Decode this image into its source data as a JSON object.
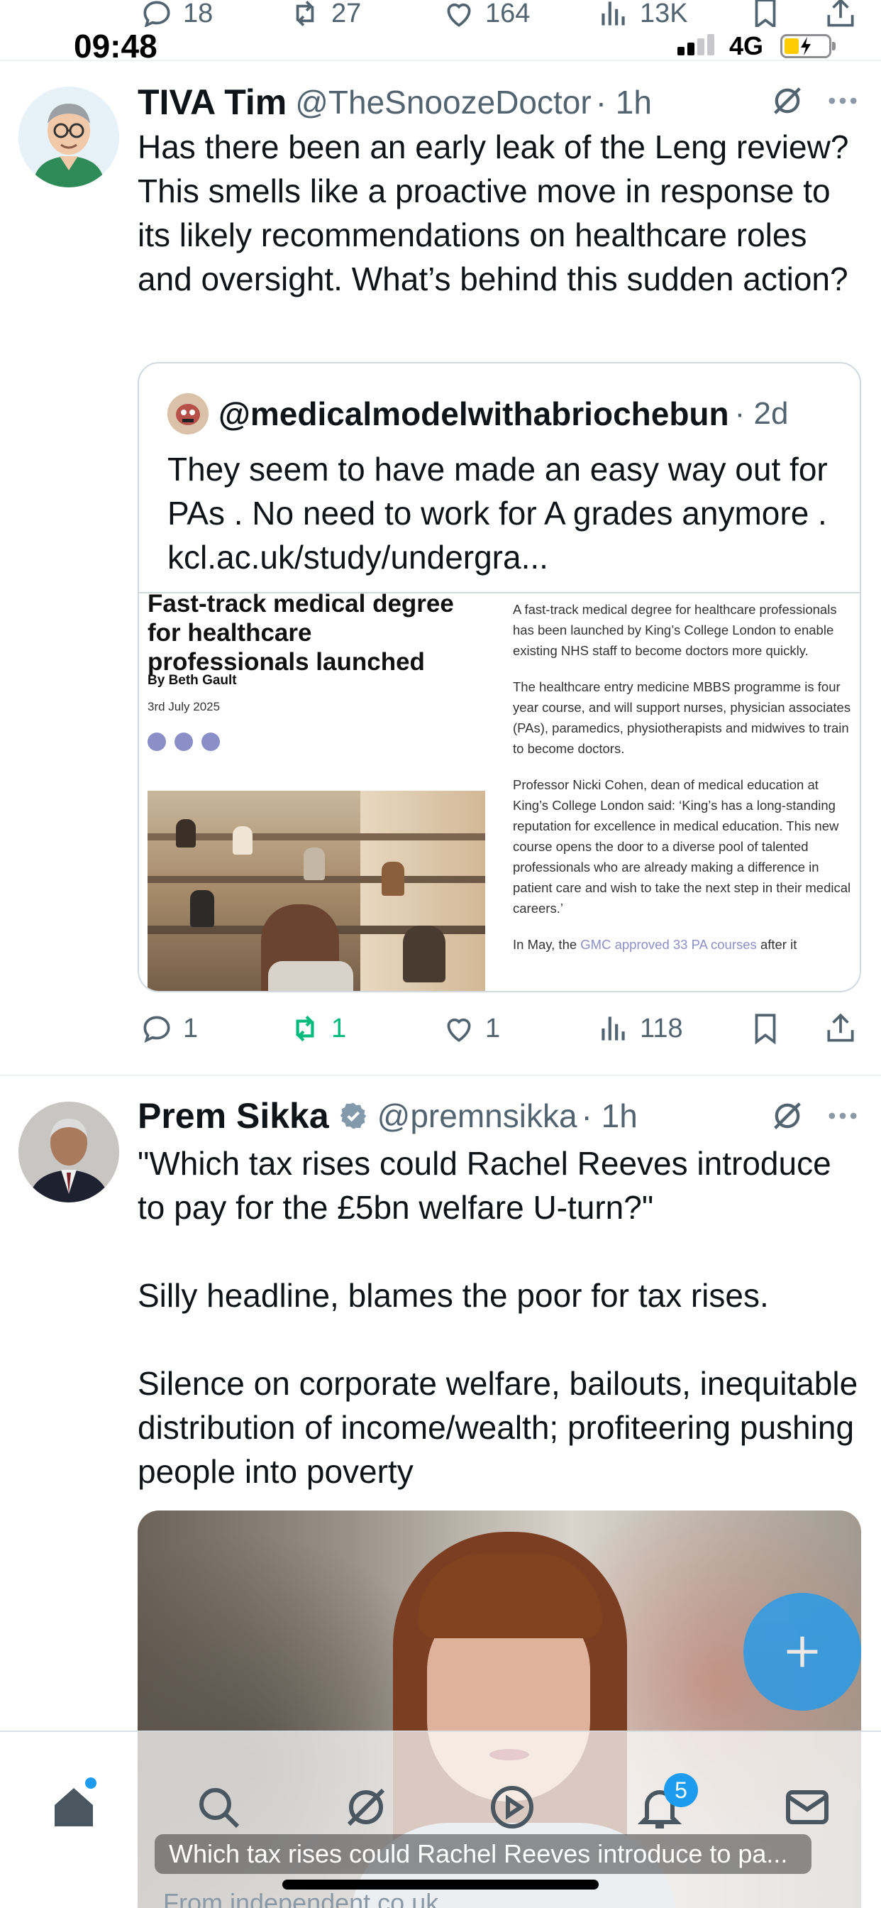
{
  "status_bar": {
    "time": "09:48",
    "network": "4G"
  },
  "prev_tweet_actions": {
    "replies": "18",
    "retweets": "27",
    "likes": "164",
    "views": "13K"
  },
  "tweet1": {
    "name": "TIVA Tim",
    "handle": "@TheSnoozeDoctor",
    "time": "· 1h",
    "text": "Has there been an early leak of the Leng review? This smells like a proactive move in response to its likely recommendations on healthcare roles and oversight. What’s behind this sudden action?",
    "quote": {
      "handle": "@medicalmodelwithabriochebun",
      "time": "· 2d",
      "text": "They seem to have made an easy way out for PAs . No need to work for A grades anymore . kcl.ac.uk/study/undergra...",
      "article": {
        "headline": "Fast-track medical degree for healthcare professionals launched",
        "byline": "By Beth Gault",
        "date": "3rd July 2025",
        "p1": "A fast-track medical degree for healthcare professionals has been launched by King’s College London to enable existing NHS staff to become doctors more quickly.",
        "p2": "The healthcare entry medicine MBBS programme is four year course, and will support nurses, physician associates (PAs), paramedics, physiotherapists and midwives to train to become doctors.",
        "p3": "Professor Nicki Cohen, dean of medical education at King’s College London said: ‘King’s has a long-standing reputation for excellence in medical education. This new course opens the door to a diverse pool of talented professionals who are already making a difference in patient care and wish to take the next step in their medical careers.’",
        "p4_start": "In May, the",
        "p4_link": "GMC approved 33 PA courses",
        "p4_end": "after it"
      }
    },
    "actions": {
      "replies": "1",
      "retweets": "1",
      "likes": "1",
      "views": "118"
    }
  },
  "tweet2": {
    "name": "Prem Sikka",
    "handle": "@premnsikka",
    "time": "· 1h",
    "text": "\"Which tax rises could Rachel Reeves introduce to pay for the £5bn welfare U-turn?\"\n\nSilly headline, blames the poor for tax rises.\n\nSilence on corporate welfare, bailouts, inequitable distribution of income/wealth; profiteering pushing people into poverty",
    "card_title": "Which tax rises could Rachel Reeves introduce to pa...",
    "card_source": "From independent.co.uk"
  },
  "bottom_nav": {
    "notifications_badge": "5"
  },
  "colors": {
    "accent": "#1d9bf0",
    "retweet": "#00ba7c",
    "muted": "#536471",
    "border": "#cfd9de"
  },
  "icons": {
    "reply": "speech-bubble-icon",
    "retweet": "retweet-icon",
    "like": "heart-icon",
    "views": "bar-chart-icon",
    "bookmark": "bookmark-icon",
    "share": "share-icon",
    "grok": "grok-icon",
    "more": "more-icon",
    "verified": "verified-badge-icon",
    "compose": "plus-icon",
    "home": "home-icon",
    "search": "search-icon",
    "video": "play-icon",
    "notifications": "bell-icon",
    "messages": "envelope-icon"
  }
}
